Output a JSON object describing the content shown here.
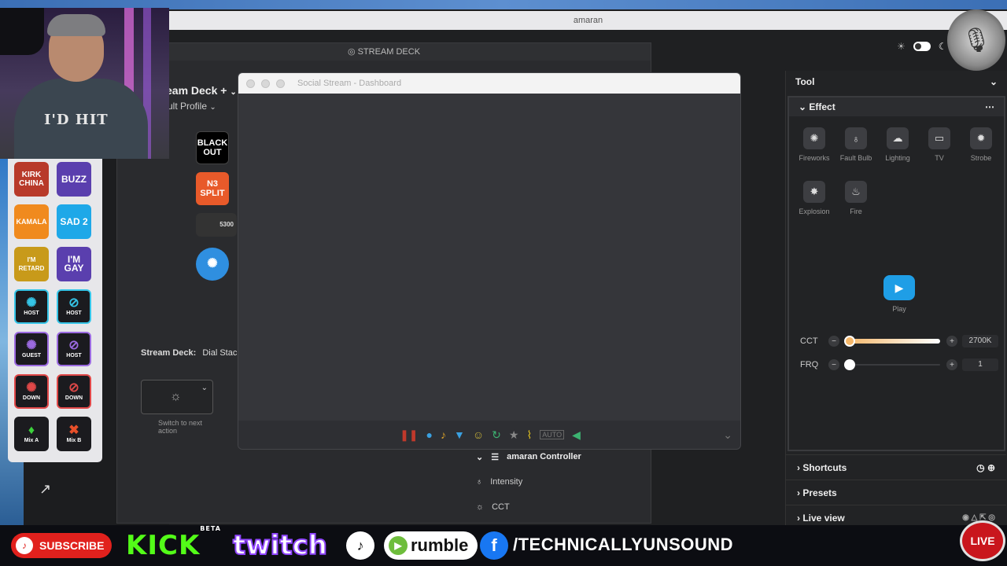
{
  "amaran": {
    "title": "amaran"
  },
  "stream_deck": {
    "window_title": "STREAM DECK",
    "device": "eam Deck +",
    "profile": "ult Profile",
    "keys": [
      {
        "label": "BLACK OUT",
        "color": "#000000"
      },
      {
        "label": "N3 SPLIT",
        "color": "#e85a2a"
      },
      {
        "label": "5300",
        "color": "#333333"
      },
      {
        "label": "",
        "color": "#2f8fe0"
      }
    ],
    "bottom_label": "Stream Deck:",
    "bottom_value": "Dial Stack",
    "switch_hint": "Switch to next action",
    "controller": "amaran Controller",
    "rows": [
      "Intensity",
      "CCT"
    ]
  },
  "tool_panel": {
    "title": "Tool",
    "effect_title": "Effect",
    "effects": [
      "Fireworks",
      "Fault Bulb",
      "Lighting",
      "TV",
      "Strobe",
      "Explosion",
      "Fire"
    ],
    "play_label": "Play",
    "cct": {
      "label": "CCT",
      "value": "2700K",
      "level": 0
    },
    "frq": {
      "label": "FRQ",
      "value": "1",
      "level": 0
    },
    "sections": [
      "Shortcuts",
      "Presets",
      "Live view"
    ]
  },
  "social_stream": {
    "title": "Social Stream - Dashboard"
  },
  "webcam": {
    "shirt_text": "I'D HIT"
  },
  "key_panel": {
    "keys": [
      {
        "label": "KIRK CHINA",
        "color": "#b83a2a"
      },
      {
        "label": "BUZZ",
        "color": "#5a3fae"
      },
      {
        "label": "KAMALA",
        "color": "#f08a1e"
      },
      {
        "label": "SAD 2",
        "color": "#1ea8e8"
      },
      {
        "label": "I'M RETARD",
        "color": "#c89a1a"
      },
      {
        "label": "I'M GAY",
        "color": "#5a3fae"
      },
      {
        "label": "HOST",
        "color": "#1b1b1f"
      },
      {
        "label": "HOST",
        "color": "#1b1b1f"
      },
      {
        "label": "GUEST",
        "color": "#1b1b1f"
      },
      {
        "label": "HOST",
        "color": "#1b1b1f"
      },
      {
        "label": "DOWN",
        "color": "#1b1b1f"
      },
      {
        "label": "DOWN",
        "color": "#1b1b1f"
      },
      {
        "label": "Mix A",
        "color": "#1b1b1f"
      },
      {
        "label": "Mix B",
        "color": "#1b1b1f"
      }
    ]
  },
  "social_bar": {
    "subscribe": "SUBSCRIBE",
    "kick": "KICK",
    "kick_badge": "BETA",
    "twitch": "twitch",
    "rumble": "rumble",
    "handle": "/TECHNICALLYUNSOUND",
    "live": "LIVE"
  }
}
